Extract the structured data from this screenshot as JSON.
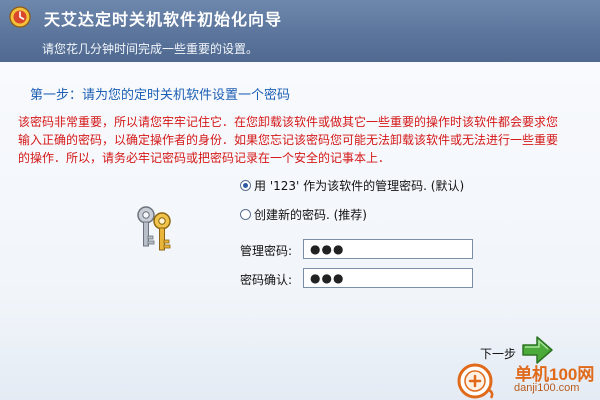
{
  "window": {
    "title": "天艾达定时关机软件初始化向导",
    "subtitle": "请您花几分钟时间完成一些重要的设置。"
  },
  "step": {
    "title": "第一步：请为您的定时关机软件设置一个密码"
  },
  "warning": {
    "lines": [
      "该密码非常重要，所以请您牢牢记住它．在您卸载该软件或做其它一些重要的操作时该软件都会要求您",
      "输入正确的密码，以确定操作者的身份．如果您忘记该密码您可能无法卸载该软件或无法进行一些重要",
      "的操作．所以，请务必牢记密码或把密码记录在一个安全的记事本上．"
    ],
    "color": "#d41818"
  },
  "options": {
    "default_label": "用 '123' 作为该软件的管理密码. (默认)",
    "create_label": "创建新的密码. (推荐)",
    "selected": "default"
  },
  "fields": {
    "admin_password_label": "管理密码:",
    "admin_password_value": "●●●",
    "confirm_password_label": "密码确认:",
    "confirm_password_value": "●●●"
  },
  "navigation": {
    "next_label": "下一步"
  },
  "watermark": {
    "site_name": "单机100网",
    "domain": "danji100.com"
  },
  "icons": {
    "app": "app-icon",
    "keys": "keys-icon",
    "next": "green-arrow-right-icon"
  },
  "colors": {
    "titlebar": "#5b759c",
    "step_title": "#1d5fb3",
    "next_arrow": "#4caa3b"
  }
}
